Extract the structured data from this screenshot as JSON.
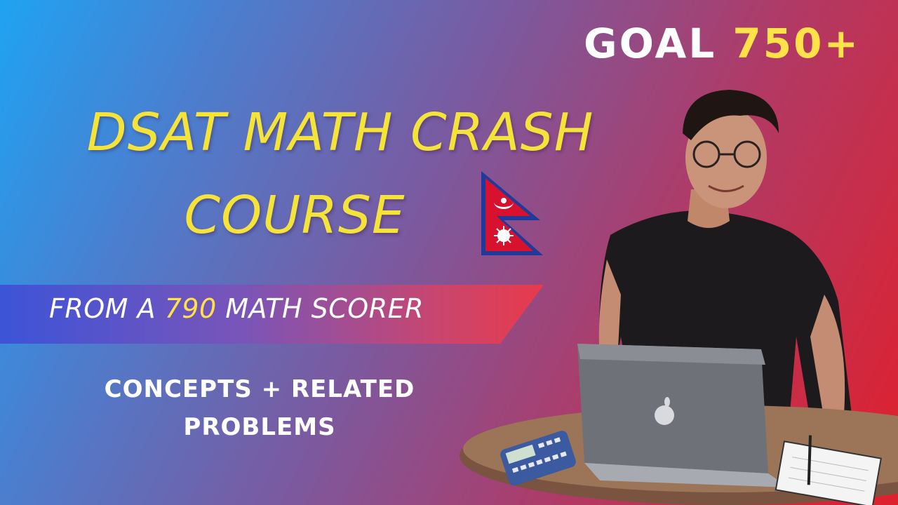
{
  "goal": {
    "prefix": "GOAL",
    "score": "750+"
  },
  "title": {
    "line1": "DSAT MATH CRASH",
    "line2": "COURSE"
  },
  "banner": {
    "prefix": "FROM A",
    "score": "790",
    "suffix": "MATH SCORER"
  },
  "subtitle": {
    "line1": "CONCEPTS + RELATED",
    "line2": "PROBLEMS"
  },
  "flag_icon": "nepal-flag-icon",
  "colors": {
    "accent_yellow": "#ffe14a",
    "title_yellow": "#f4e43a",
    "white": "#ffffff"
  }
}
